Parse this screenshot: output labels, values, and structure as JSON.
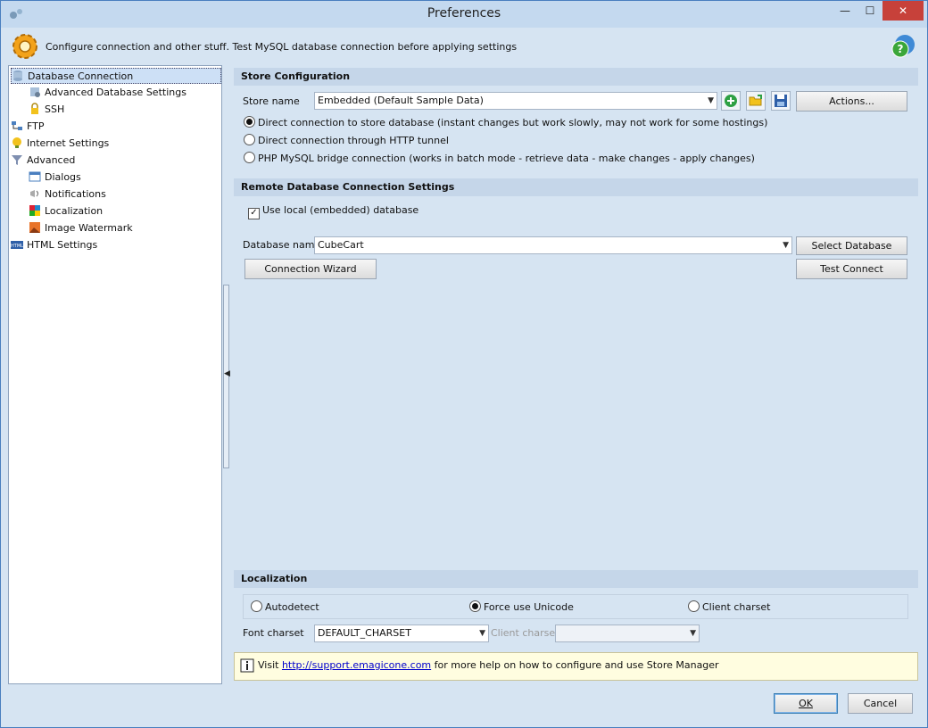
{
  "window": {
    "title": "Preferences",
    "min": "—",
    "max": "☐",
    "close": "✕"
  },
  "header": {
    "text": "Configure connection and other stuff. Test MySQL database connection before applying settings"
  },
  "tree": [
    {
      "label": "Database Connection",
      "level": 0,
      "icon": "database-icon",
      "selected": true
    },
    {
      "label": "Advanced Database Settings",
      "level": 1,
      "icon": "database-settings-icon"
    },
    {
      "label": "SSH",
      "level": 1,
      "icon": "lock-icon"
    },
    {
      "label": "FTP",
      "level": 0,
      "icon": "ftp-icon"
    },
    {
      "label": "Internet Settings",
      "level": 0,
      "icon": "internet-icon"
    },
    {
      "label": "Advanced",
      "level": 0,
      "icon": "funnel-icon"
    },
    {
      "label": "Dialogs",
      "level": 1,
      "icon": "dialog-icon"
    },
    {
      "label": "Notifications",
      "level": 1,
      "icon": "notification-icon"
    },
    {
      "label": "Localization",
      "level": 1,
      "icon": "localization-icon"
    },
    {
      "label": "Image Watermark",
      "level": 1,
      "icon": "image-icon"
    },
    {
      "label": "HTML Settings",
      "level": 0,
      "icon": "html-icon"
    }
  ],
  "store": {
    "heading": "Store Configuration",
    "name_label": "Store name",
    "name_value": "Embedded (Default Sample Data)",
    "actions": "Actions...",
    "radios": [
      {
        "label": "Direct connection to store database (instant changes but work slowly, may not work for some hostings)",
        "checked": true
      },
      {
        "label": "Direct connection through HTTP tunnel",
        "checked": false
      },
      {
        "label": "PHP MySQL bridge connection (works in batch mode - retrieve data - make changes - apply changes)",
        "checked": false
      }
    ]
  },
  "remote": {
    "heading": "Remote Database Connection Settings",
    "use_local": "Use local (embedded) database",
    "db_label": "Database name",
    "db_value": "CubeCart",
    "select_db": "Select Database",
    "wizard": "Connection Wizard",
    "test": "Test Connect"
  },
  "localization": {
    "heading": "Localization",
    "autodetect": "Autodetect",
    "unicode": "Force use Unicode",
    "client": "Client charset",
    "font_label": "Font charset",
    "font_value": "DEFAULT_CHARSET",
    "client_label": "Client charset",
    "client_value": ""
  },
  "info": {
    "pre": "Visit ",
    "link": "http://support.emagicone.com",
    "post": " for more help on how to configure and use Store Manager"
  },
  "footer": {
    "ok": "OK",
    "cancel": "Cancel"
  },
  "colors": {
    "accent": "#3c7fb1",
    "close_red": "#c7413a",
    "panel_bg": "#d6e4f2"
  }
}
